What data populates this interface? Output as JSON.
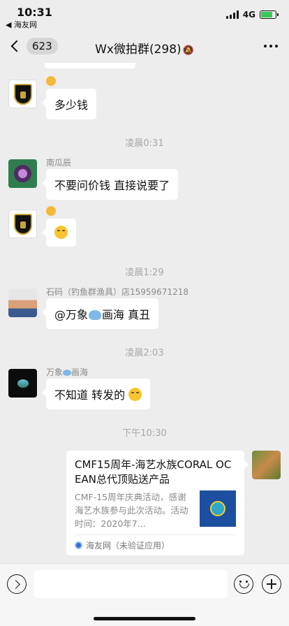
{
  "status_bar": {
    "time": "10:31",
    "back_app": "◀ 海友网",
    "network": "4G"
  },
  "nav": {
    "back_count": "623",
    "title": "Wx微拍群(298)",
    "mute_icon": "🔕"
  },
  "messages": [
    {
      "sender": "",
      "text": "多少钱",
      "avatar": "lamborghini-logo"
    },
    {
      "timestamp": "凌晨0:31"
    },
    {
      "sender": "南瓜辰",
      "text": "不要问价钱 直接说要了",
      "avatar": "flower"
    },
    {
      "sender": "",
      "text": "",
      "avatar": "lamborghini-logo",
      "emoji": "face-emoji"
    },
    {
      "timestamp": "凌晨1:29"
    },
    {
      "sender": "石码（钓鱼群渔具）店15959671218",
      "text_prefix": "@万象",
      "text_suffix": "画海 真丑",
      "avatar": "person-photo"
    },
    {
      "timestamp": "凌晨2:03"
    },
    {
      "sender_prefix": "万象",
      "sender_suffix": "画海",
      "text": "不知道 转发的",
      "avatar": "dark-logo"
    },
    {
      "timestamp": "下午10:30"
    }
  ],
  "link_card": {
    "title": "CMF15周年-海艺水族CORAL OCEAN总代顶贴送产品",
    "description": "CMF-15周年庆典活动，感谢海艺水族参与此次活动。活动时间：2020年7...",
    "source": "海友网（未验证应用）"
  },
  "input_bar": {
    "placeholder": ""
  }
}
